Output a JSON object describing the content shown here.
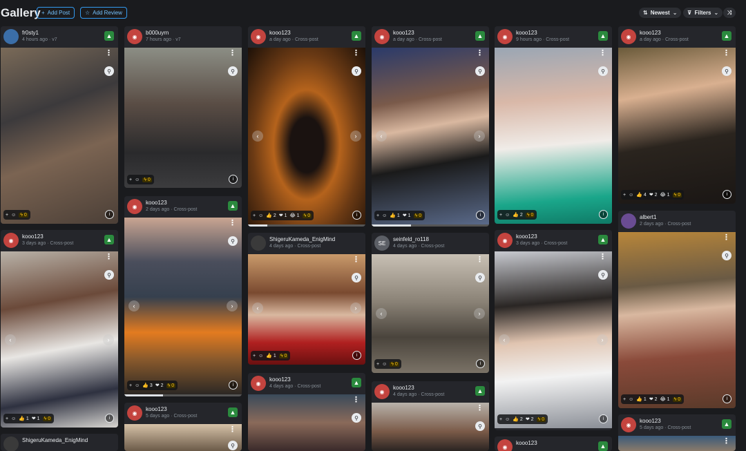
{
  "header": {
    "title": "Gallery",
    "add_post": "Add Post",
    "add_review": "Add Review",
    "sort": "Newest",
    "filters": "Filters"
  },
  "cards": {
    "c1": {
      "user": "fr0sty1",
      "time": "4 hours ago · v7"
    },
    "c2": {
      "user": "kooo123",
      "time": "3 days ago · Cross-post"
    },
    "c3": {
      "user": "ShigeruKameda_EnigMind"
    },
    "c4": {
      "user": "b000uyrn",
      "time": "7 hours ago · v7"
    },
    "c5": {
      "user": "kooo123",
      "time": "2 days ago · Cross-post"
    },
    "c6": {
      "user": "kooo123",
      "time": "5 days ago · Cross-post"
    },
    "c7": {
      "user": "kooo123",
      "time": "a day ago · Cross-post"
    },
    "c8": {
      "user": "ShigeruKameda_EnigMind",
      "time": "4 days ago · Cross-post"
    },
    "c9": {
      "user": "kooo123",
      "time": "4 days ago · Cross-post"
    },
    "c10": {
      "user": "kooo123",
      "time": "a day ago · Cross-post"
    },
    "c11": {
      "user": "seinfeld_ro118",
      "time": "4 days ago · Cross-post",
      "initials": "SE"
    },
    "c12": {
      "user": "kooo123",
      "time": "4 days ago · Cross-post"
    },
    "c13": {
      "user": "kooo123",
      "time": "9 hours ago · Cross-post"
    },
    "c14": {
      "user": "kooo123",
      "time": "3 days ago · Cross-post"
    },
    "c15": {
      "user": "kooo123"
    },
    "c16": {
      "user": "kooo123",
      "time": "a day ago · Cross-post"
    },
    "c17": {
      "user": "albert1",
      "time": "2 days ago · Cross-post"
    },
    "c18": {
      "user": "kooo123",
      "time": "5 days ago · Cross-post"
    }
  },
  "reactions": {
    "r1": {
      "buzz": "0"
    },
    "r2": {
      "like": "1",
      "heart": "1",
      "buzz": "0"
    },
    "r4": {
      "buzz": "0"
    },
    "r5": {
      "like": "3",
      "heart": "2",
      "buzz": "0"
    },
    "r7": {
      "like": "2",
      "heart": "1",
      "laugh": "1",
      "buzz": "0"
    },
    "r8": {
      "like": "1",
      "buzz": "0"
    },
    "r10": {
      "like": "1",
      "heart": "1",
      "buzz": "0"
    },
    "r11": {
      "buzz": "0"
    },
    "r13": {
      "like": "2",
      "buzz": "0"
    },
    "r14": {
      "like": "2",
      "heart": "2",
      "buzz": "0"
    },
    "r16": {
      "like": "4",
      "heart": "2",
      "laugh": "1",
      "buzz": "0"
    },
    "r17": {
      "like": "1",
      "heart": "2",
      "laugh": "1",
      "buzz": "0"
    }
  },
  "colors": {
    "background": "#1a1b1e",
    "card": "#25262b",
    "accent_blue": "#339af0",
    "like_green": "#2b8a3e",
    "buzz_yellow": "#fcc419"
  },
  "icons": [
    "filter-icon",
    "shuffle-icon",
    "sort-icon",
    "thumbs-up-icon",
    "link-icon",
    "info-icon",
    "plus-icon",
    "emoji-icon",
    "bolt-icon",
    "star-icon"
  ]
}
